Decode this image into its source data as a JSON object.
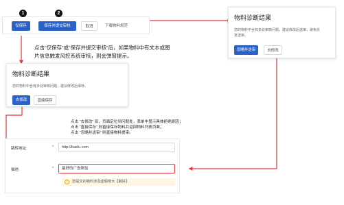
{
  "toolbar": {
    "save_label": "仅保存",
    "save_submit_label": "保存并提交审核",
    "cancel_label": "取消",
    "download_label": "下载物料规范"
  },
  "markers": {
    "one": "1",
    "two": "2"
  },
  "note_top": {
    "line1": "点击“仅保存”或“保存并提交审核”后，如果物料中有文本或图",
    "line2": "片信息触发风控系统审核，则会弹窗提示。"
  },
  "dialog_left": {
    "title": "物料诊断结果",
    "message": "您的物料中含有多处审核问题，建议修改后保存。",
    "primary_label": "去修改",
    "secondary_label": "直接保存"
  },
  "dialog_right": {
    "title": "物料诊断结果",
    "message_line1": "您的物料中含有多处审核问题，建议修改后送审，避免反",
    "message_line2": "复送审。",
    "primary_label": "忽略并送审",
    "secondary_label": "去修改"
  },
  "note_bottom": {
    "line1": "点击 “去修改” 后，页面定位到问题处，表单中显示具体拒绝原因；",
    "line2": "点击 “直接保存” 则直接保存物料并返回物料列表页面；",
    "line3": "点击 “忽略并送审” 则直接物料提审。"
  },
  "form": {
    "url_label": "跳转地址:",
    "url_value": "http://baidu.com",
    "desc_label": "描述:",
    "desc_value": "最好的广告体验",
    "required_mark": "*",
    "warning_text": "您提交的物料涉及虚假夸大【最好】"
  },
  "colors": {
    "primary": "#2a62c9",
    "arrow": "#e0353b",
    "error": "#e0353b",
    "warning": "#e8a317"
  }
}
